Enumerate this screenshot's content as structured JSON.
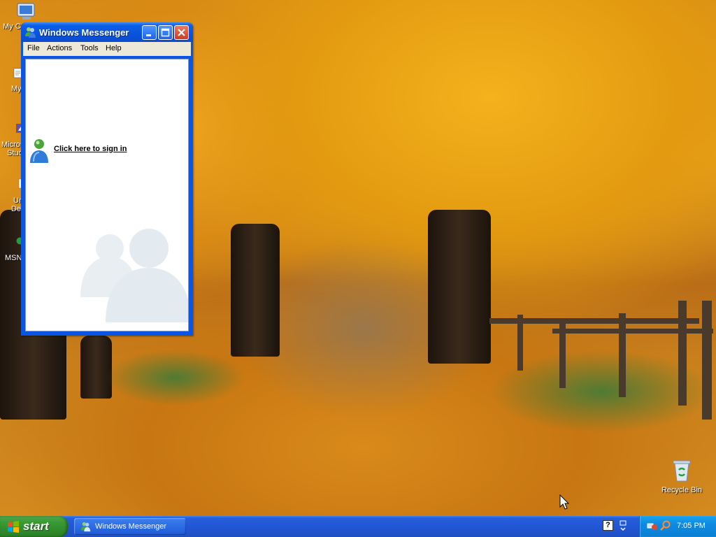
{
  "desktop": {
    "icons": [
      {
        "label": "My C",
        "icon": "my-computer-icon"
      },
      {
        "label": "My",
        "icon": "my-documents-icon"
      },
      {
        "label_line1": "Micros",
        "label_line2": "Studi",
        "icon": "shortcut-icon"
      },
      {
        "label_line1": "Ur",
        "label_line2": "Des",
        "icon": "shortcut-icon"
      },
      {
        "label": "MSN",
        "icon": "msn-icon"
      }
    ],
    "recycle_bin": {
      "label": "Recycle Bin",
      "icon": "recycle-bin-icon"
    }
  },
  "messenger": {
    "title": "Windows Messenger",
    "menu": [
      "File",
      "Actions",
      "Tools",
      "Help"
    ],
    "sign_in_link": "Click here to sign in",
    "title_buttons": [
      "minimize",
      "maximize",
      "close"
    ]
  },
  "taskbar": {
    "start_label": "start",
    "tasks": [
      {
        "label": "Windows Messenger",
        "icon": "messenger-icon"
      }
    ],
    "tray_help_glyph": "?",
    "clock": "7:05 PM"
  },
  "colors": {
    "xp_blue": "#0a55e4",
    "start_green": "#3a9a35",
    "tray_blue": "#0d8ae0",
    "menu_bg": "#ece9d8"
  }
}
